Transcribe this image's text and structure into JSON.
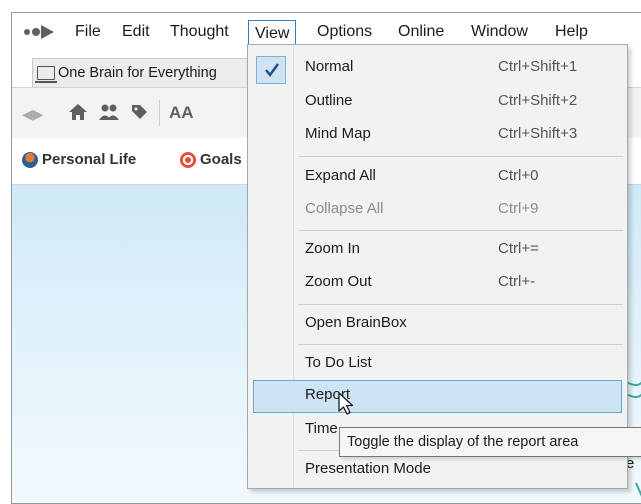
{
  "menubar": {
    "items": [
      "File",
      "Edit",
      "Thought",
      "View",
      "Options",
      "Online",
      "Window",
      "Help"
    ],
    "active": "View"
  },
  "tab": {
    "label": "One Brain for Everything"
  },
  "toolbar": {
    "font_label": "AA"
  },
  "pins": [
    {
      "label": "Personal Life",
      "icon": "person-icon"
    },
    {
      "label": "Goals",
      "icon": "target-icon"
    }
  ],
  "view_menu": {
    "items": [
      {
        "label": "Normal",
        "shortcut": "Ctrl+Shift+1",
        "checked": true
      },
      {
        "label": "Outline",
        "shortcut": "Ctrl+Shift+2"
      },
      {
        "label": "Mind Map",
        "shortcut": "Ctrl+Shift+3"
      },
      {
        "label": "Expand All",
        "shortcut": "Ctrl+0"
      },
      {
        "label": "Collapse All",
        "shortcut": "Ctrl+9",
        "disabled": true
      },
      {
        "label": "Zoom In",
        "shortcut": "Ctrl+="
      },
      {
        "label": "Zoom Out",
        "shortcut": "Ctrl+-"
      },
      {
        "label": "Open BrainBox",
        "shortcut": ""
      },
      {
        "label": "To Do List",
        "shortcut": ""
      },
      {
        "label": "Report",
        "shortcut": "",
        "highlighted": true
      },
      {
        "label": "Time",
        "shortcut": ""
      },
      {
        "label": "Presentation Mode",
        "shortcut": ""
      }
    ]
  },
  "tooltip": {
    "text": "Toggle the display of the report area"
  },
  "edge_fragment": "e",
  "colors": {
    "accent": "#2f7fc0",
    "highlight_bg": "#cde4f4",
    "canvas_top": "#cfe9f8",
    "menu_bg": "#f2f2f2"
  }
}
